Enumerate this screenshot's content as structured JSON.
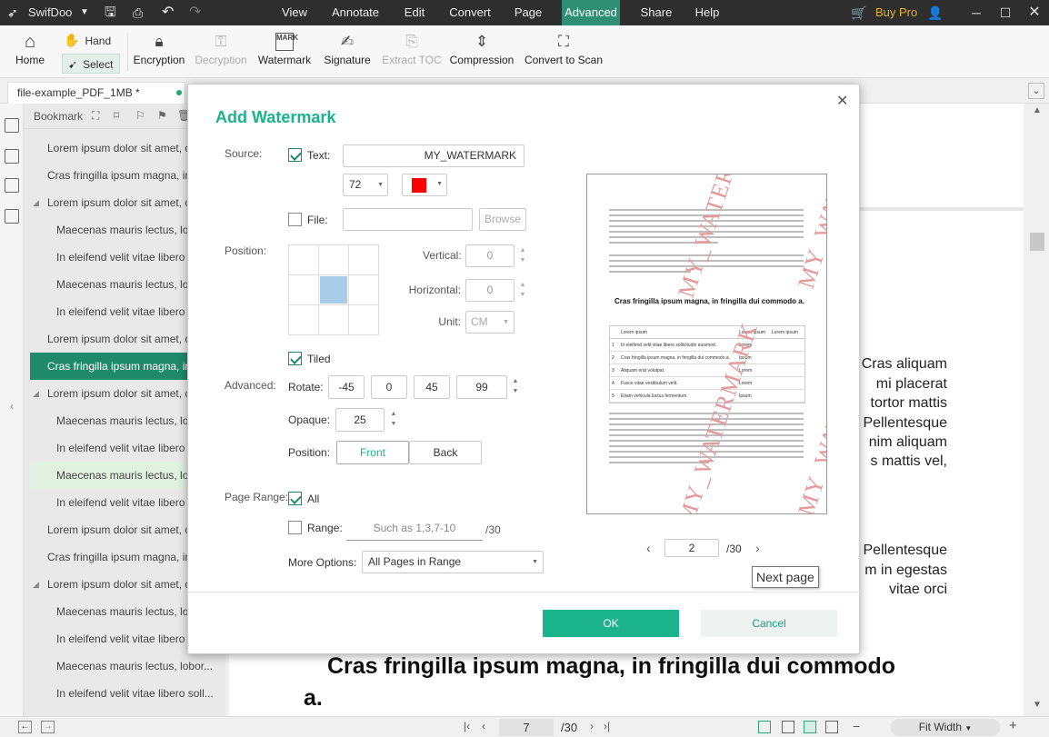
{
  "app": {
    "name": "SwifDoo"
  },
  "menu": [
    "View",
    "Annotate",
    "Edit",
    "Convert",
    "Page",
    "Advanced",
    "Share",
    "Help"
  ],
  "active_menu": "Advanced",
  "buy_pro": "Buy Pro",
  "ribbon": {
    "home": "Home",
    "hand": "Hand",
    "select": "Select",
    "encryption": "Encryption",
    "decryption": "Decryption",
    "watermark": "Watermark",
    "signature": "Signature",
    "extract_toc": "Extract TOC",
    "compression": "Compression",
    "convert_to_scan": "Convert to Scan"
  },
  "tab": {
    "label": "file-example_PDF_1MB *"
  },
  "sidebar": {
    "title": "Bookmark",
    "items": [
      {
        "label": "Lorem ipsum dolor sit amet, c",
        "indent": 0,
        "arrow": false
      },
      {
        "label": "Cras fringilla ipsum magna, in",
        "indent": 0,
        "arrow": false
      },
      {
        "label": "Lorem ipsum dolor sit amet, c",
        "indent": 0,
        "arrow": true
      },
      {
        "label": "Maecenas mauris lectus, lob",
        "indent": 1,
        "arrow": false
      },
      {
        "label": "In eleifend velit vitae libero",
        "indent": 1,
        "arrow": false
      },
      {
        "label": "Maecenas mauris lectus, lob",
        "indent": 1,
        "arrow": false
      },
      {
        "label": "In eleifend velit vitae libero",
        "indent": 1,
        "arrow": false
      },
      {
        "label": "Lorem ipsum dolor sit amet, c",
        "indent": 0,
        "arrow": false
      },
      {
        "label": "Cras fringilla ipsum magna, in",
        "indent": 0,
        "arrow": false,
        "selected": true
      },
      {
        "label": "Lorem ipsum dolor sit amet, c",
        "indent": 0,
        "arrow": true
      },
      {
        "label": "Maecenas mauris lectus, lob",
        "indent": 1,
        "arrow": false
      },
      {
        "label": "In eleifend velit vitae libero",
        "indent": 1,
        "arrow": false
      },
      {
        "label": "Maecenas mauris lectus, lob",
        "indent": 1,
        "arrow": false,
        "hover": true
      },
      {
        "label": "In eleifend velit vitae libero",
        "indent": 1,
        "arrow": false
      },
      {
        "label": "Lorem ipsum dolor sit amet, c",
        "indent": 0,
        "arrow": false
      },
      {
        "label": "Cras fringilla ipsum magna, in",
        "indent": 0,
        "arrow": false
      },
      {
        "label": "Lorem ipsum dolor sit amet, c",
        "indent": 0,
        "arrow": true
      },
      {
        "label": "Maecenas mauris lectus, lob",
        "indent": 1,
        "arrow": false
      },
      {
        "label": "In eleifend velit vitae libero",
        "indent": 1,
        "arrow": false
      },
      {
        "label": "Maecenas mauris lectus, lobor...",
        "indent": 1,
        "arrow": false
      },
      {
        "label": "In eleifend velit vitae libero soll...",
        "indent": 1,
        "arrow": false
      }
    ]
  },
  "document": {
    "fragments": [
      "Cras aliquam",
      "mi placerat",
      "tortor mattis",
      "Pellentesque",
      "nim aliquam",
      "s mattis vel,",
      "Pellentesque",
      "m in egestas",
      "vitae orci"
    ],
    "heading": "Cras fringilla ipsum magna, in fringilla dui commodo",
    "heading_tail": "a."
  },
  "status": {
    "page": "7",
    "total": "/30",
    "fit": "Fit Width"
  },
  "dialog": {
    "title": "Add Watermark",
    "source_label": "Source:",
    "text_label": "Text:",
    "text_value": "MY_WATERMARK",
    "text_checked": true,
    "font_size": "72",
    "color": "#ff0000",
    "file_label": "File:",
    "file_checked": false,
    "browse": "Browse",
    "position_label": "Position:",
    "vertical_label": "Vertical:",
    "vertical_value": "0",
    "horizontal_label": "Horizontal:",
    "horizontal_value": "0",
    "unit_label": "Unit:",
    "unit_value": "CM",
    "tiled_label": "Tiled",
    "tiled_checked": true,
    "advanced_label": "Advanced:",
    "rotate_label": "Rotate:",
    "rotate_options": [
      "-45",
      "0",
      "45"
    ],
    "rotate_value": "99",
    "opaque_label": "Opaque:",
    "opaque_value": "25",
    "layer_label": "Position:",
    "front": "Front",
    "back": "Back",
    "page_range_label": "Page Range:",
    "all_label": "All",
    "all_checked": true,
    "range_label": "Range:",
    "range_checked": false,
    "range_placeholder": "Such as 1,3,7-10",
    "range_total": "/30",
    "more_options_label": "More Options:",
    "more_options_value": "All Pages in Range",
    "preview_page": "2",
    "preview_total": "/30",
    "next_page_tip": "Next page",
    "ok": "OK",
    "cancel": "Cancel",
    "preview": {
      "heading": "Cras fringilla ipsum magna, in fringilla dui commodo a.",
      "watermark_text": "MY_WATERMARK",
      "table_header": [
        "Lorem ipsum",
        "Lorem ipsum",
        "Lorem ipsum"
      ],
      "table_rows": [
        [
          "1",
          "In eleifend velit vitae libero sollicitudin euismod.",
          "Lorem"
        ],
        [
          "2",
          "Cras fringilla ipsum magna, in fringilla dui commodo a.",
          "Ipsum"
        ],
        [
          "3",
          "Aliquam erat volutpat.",
          "Lorem"
        ],
        [
          "4",
          "Fusce vitae vestibulum velit.",
          "Lorem"
        ],
        [
          "5",
          "Etiam vehicula luctus fermentum.",
          "Ipsum"
        ]
      ]
    }
  },
  "colors": {
    "accent": "#1f8a68",
    "titlebar": "#2e2e2e",
    "dialog_title": "#1ab38a"
  }
}
